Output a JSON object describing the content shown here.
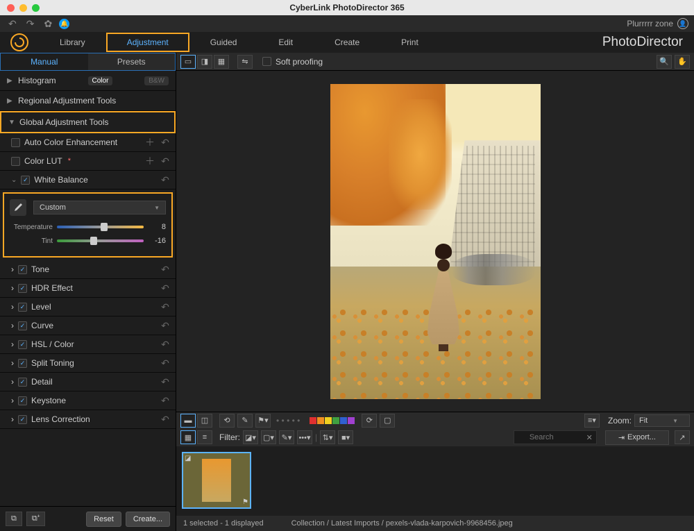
{
  "window": {
    "title": "CyberLink PhotoDirector 365"
  },
  "user": {
    "name": "Plurrrrr zone"
  },
  "brand": "PhotoDirector",
  "nav": {
    "library": "Library",
    "adjustment": "Adjustment",
    "guided": "Guided",
    "edit": "Edit",
    "create": "Create",
    "print": "Print"
  },
  "sideTabs": {
    "manual": "Manual",
    "presets": "Presets"
  },
  "histogram": {
    "label": "Histogram",
    "color": "Color",
    "bw": "B&W"
  },
  "sections": {
    "regional": "Regional Adjustment Tools",
    "global": "Global Adjustment Tools"
  },
  "adjust": {
    "autoColor": "Auto Color Enhancement",
    "colorLut": "Color LUT",
    "whiteBalance": "White Balance",
    "wbPreset": "Custom",
    "temperature": {
      "label": "Temperature",
      "value": 8
    },
    "tint": {
      "label": "Tint",
      "value": -16
    },
    "tone": "Tone",
    "hdr": "HDR Effect",
    "level": "Level",
    "curve": "Curve",
    "hsl": "HSL / Color",
    "split": "Split Toning",
    "detail": "Detail",
    "keystone": "Keystone",
    "lens": "Lens Correction"
  },
  "footer": {
    "reset": "Reset",
    "create": "Create..."
  },
  "viewBar": {
    "softProofing": "Soft proofing"
  },
  "lower": {
    "zoomLabel": "Zoom:",
    "zoomValue": "Fit",
    "filter": "Filter:",
    "searchPlaceholder": "Search",
    "export": "Export..."
  },
  "status": {
    "selection": "1 selected - 1 displayed",
    "path": "Collection / Latest Imports / pexels-vlada-karpovich-9968456.jpeg"
  },
  "colorSwatches": [
    "#e03030",
    "#f09020",
    "#f0d020",
    "#40a040",
    "#3060d0",
    "#a040d0"
  ]
}
